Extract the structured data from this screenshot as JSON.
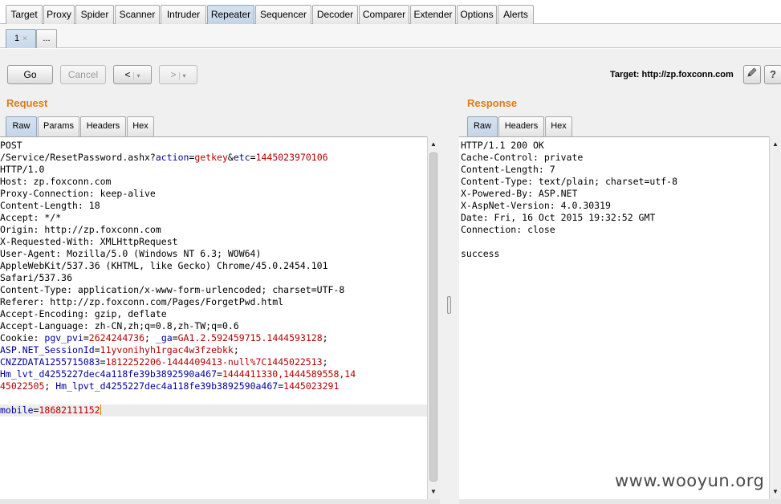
{
  "main_tabs": [
    "Target",
    "Proxy",
    "Spider",
    "Scanner",
    "Intruder",
    "Repeater",
    "Sequencer",
    "Decoder",
    "Comparer",
    "Extender",
    "Options",
    "Alerts"
  ],
  "active_main_tab": "Repeater",
  "sub_tabs": {
    "current": "1",
    "close_glyph": "×",
    "more": "..."
  },
  "toolbar": {
    "go": "Go",
    "cancel": "Cancel",
    "back": "<",
    "forward": ">",
    "dropdown": "▾",
    "target_label": "Target: http://zp.foxconn.com",
    "edit_icon": "pencil-icon",
    "help_label": "?"
  },
  "request": {
    "title": "Request",
    "tabs": [
      "Raw",
      "Params",
      "Headers",
      "Hex"
    ],
    "active_tab": "Raw",
    "lines": [
      {
        "text": "POST"
      },
      {
        "parts": [
          [
            "t",
            "/Service/ResetPassword.ashx?"
          ],
          [
            "k",
            "action"
          ],
          [
            "t",
            "="
          ],
          [
            "v",
            "getkey"
          ],
          [
            "t",
            "&"
          ],
          [
            "k",
            "etc"
          ],
          [
            "t",
            "="
          ],
          [
            "v",
            "1445023970106"
          ]
        ]
      },
      {
        "text": "HTTP/1.0"
      },
      {
        "text": "Host: zp.foxconn.com"
      },
      {
        "text": "Proxy-Connection: keep-alive"
      },
      {
        "text": "Content-Length: 18"
      },
      {
        "text": "Accept: */*"
      },
      {
        "text": "Origin: http://zp.foxconn.com"
      },
      {
        "text": "X-Requested-With: XMLHttpRequest"
      },
      {
        "text": "User-Agent: Mozilla/5.0 (Windows NT 6.3; WOW64)"
      },
      {
        "text": "AppleWebKit/537.36 (KHTML, like Gecko) Chrome/45.0.2454.101"
      },
      {
        "text": "Safari/537.36"
      },
      {
        "text": "Content-Type: application/x-www-form-urlencoded; charset=UTF-8"
      },
      {
        "text": "Referer: http://zp.foxconn.com/Pages/ForgetPwd.html"
      },
      {
        "text": "Accept-Encoding: gzip, deflate"
      },
      {
        "text": "Accept-Language: zh-CN,zh;q=0.8,zh-TW;q=0.6"
      },
      {
        "parts": [
          [
            "t",
            "Cookie: "
          ],
          [
            "k",
            "pgv_pvi"
          ],
          [
            "t",
            "="
          ],
          [
            "v",
            "2624244736"
          ],
          [
            "t",
            "; "
          ],
          [
            "k",
            "_ga"
          ],
          [
            "t",
            "="
          ],
          [
            "v",
            "GA1.2.592459715.1444593128"
          ],
          [
            "t",
            ";"
          ]
        ]
      },
      {
        "parts": [
          [
            "k",
            "ASP.NET_SessionId"
          ],
          [
            "t",
            "="
          ],
          [
            "v",
            "11yvonihyh1rgac4w3fzebkk"
          ],
          [
            "t",
            ";"
          ]
        ]
      },
      {
        "parts": [
          [
            "k",
            "CNZZDATA1255715083"
          ],
          [
            "t",
            "="
          ],
          [
            "v",
            "1812252206-1444409413-null%7C1445022513"
          ],
          [
            "t",
            ";"
          ]
        ]
      },
      {
        "parts": [
          [
            "k",
            "Hm_lvt_d4255227dec4a118fe39b3892590a467"
          ],
          [
            "t",
            "="
          ],
          [
            "v",
            "1444411330,1444589558,14"
          ]
        ]
      },
      {
        "parts": [
          [
            "v",
            "45022505"
          ],
          [
            "t",
            "; "
          ],
          [
            "k",
            "Hm_lpvt_d4255227dec4a118fe39b3892590a467"
          ],
          [
            "t",
            "="
          ],
          [
            "v",
            "1445023291"
          ]
        ]
      },
      {
        "text": ""
      },
      {
        "parts": [
          [
            "k",
            "mobile"
          ],
          [
            "t",
            "="
          ],
          [
            "v",
            "18682111152"
          ]
        ],
        "highlight": true,
        "caret": true
      }
    ]
  },
  "response": {
    "title": "Response",
    "tabs": [
      "Raw",
      "Headers",
      "Hex"
    ],
    "active_tab": "Raw",
    "lines": [
      {
        "text": "HTTP/1.1 200 OK"
      },
      {
        "text": "Cache-Control: private"
      },
      {
        "text": "Content-Length: 7"
      },
      {
        "text": "Content-Type: text/plain; charset=utf-8"
      },
      {
        "text": "X-Powered-By: ASP.NET"
      },
      {
        "text": "X-AspNet-Version: 4.0.30319"
      },
      {
        "text": "Date: Fri, 16 Oct 2015 19:32:52 GMT"
      },
      {
        "text": "Connection: close"
      },
      {
        "text": ""
      },
      {
        "text": "success"
      }
    ]
  },
  "watermark": "www.wooyun.org",
  "colors": {
    "section_title": "#e07b14",
    "param_name": "#00009c",
    "param_value": "#b30000",
    "caret": "#e08000"
  }
}
